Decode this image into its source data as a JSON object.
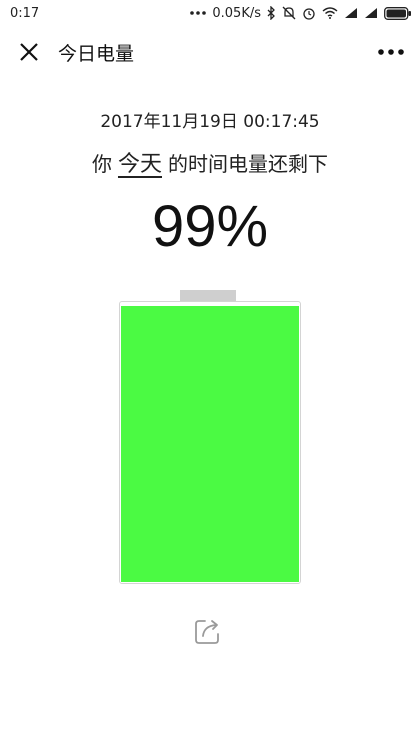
{
  "status_bar": {
    "time": "0:17",
    "network_speed": "0.05K/s",
    "icons": [
      "dots-icon",
      "bluetooth-icon",
      "mute-icon",
      "alarm-icon",
      "wifi-icon",
      "signal-icon",
      "signal-icon",
      "battery-icon"
    ]
  },
  "nav": {
    "title": "今日电量",
    "close_icon": "close-icon",
    "more_icon": "more-icon"
  },
  "content": {
    "datetime": "2017年11月19日 00:17:45",
    "remaining_prefix": "你",
    "remaining_highlight": "今天",
    "remaining_suffix": "的时间电量还剩下",
    "percent_label": "99%",
    "battery_level": 0.99,
    "battery_color": "#4bfa43"
  },
  "share": {
    "icon": "share-icon"
  }
}
